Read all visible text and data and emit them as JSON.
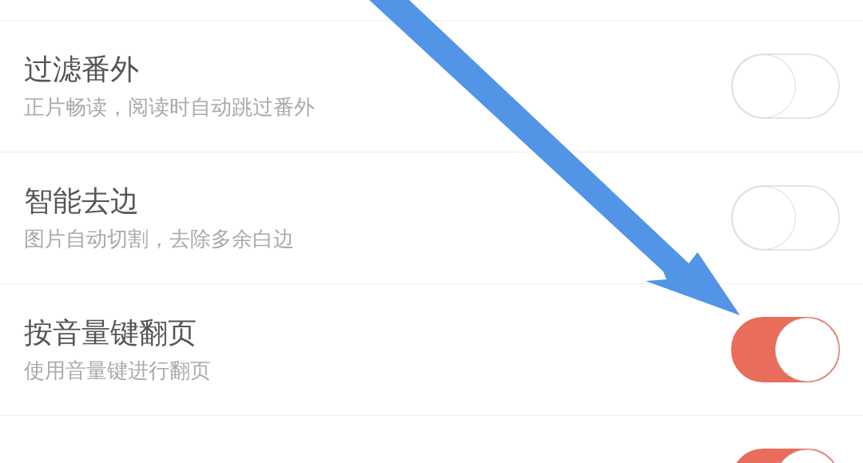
{
  "settings": [
    {
      "title": "过滤番外",
      "subtitle": "正片畅读，阅读时自动跳过番外",
      "on": false
    },
    {
      "title": "智能去边",
      "subtitle": "图片自动切割，去除多余白边",
      "on": false
    },
    {
      "title": "按音量键翻页",
      "subtitle": "使用音量键进行翻页",
      "on": true
    },
    {
      "on": true
    }
  ]
}
